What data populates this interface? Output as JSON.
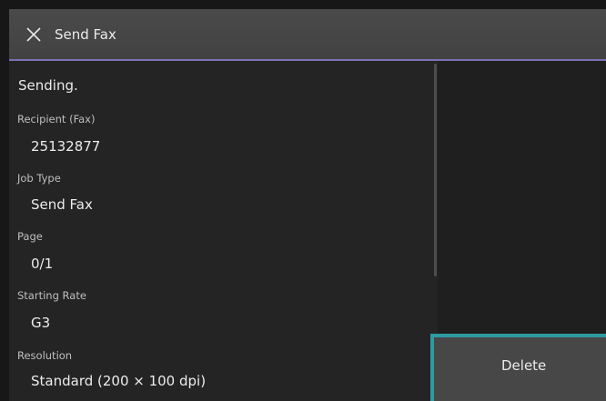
{
  "header": {
    "title": "Send Fax",
    "close_icon": "close-icon"
  },
  "job": {
    "status": "Sending.",
    "fields": [
      {
        "label": "Recipient (Fax)",
        "value": "25132877"
      },
      {
        "label": "Job Type",
        "value": "Send Fax"
      },
      {
        "label": "Page",
        "value": "0/1"
      },
      {
        "label": "Starting Rate",
        "value": "G3"
      },
      {
        "label": "Resolution",
        "value": "Standard (200 × 100 dpi)"
      }
    ]
  },
  "actions": {
    "delete_label": "Delete"
  },
  "colors": {
    "accent": "#7a72b5",
    "focus_outline": "#2f9aa3"
  }
}
